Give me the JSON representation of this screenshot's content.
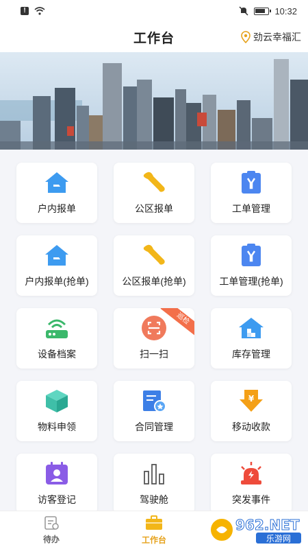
{
  "status_bar": {
    "time": "10:32"
  },
  "header": {
    "title": "工作台",
    "location": "劲云幸福汇"
  },
  "tiles": [
    {
      "label": "户内报单",
      "icon": "house-wrench-icon"
    },
    {
      "label": "公区报单",
      "icon": "wrench-icon"
    },
    {
      "label": "工单管理",
      "icon": "clipboard-wrench-icon"
    },
    {
      "label": "户内报单(抢单)",
      "icon": "house-wrench-icon"
    },
    {
      "label": "公区报单(抢单)",
      "icon": "wrench-icon"
    },
    {
      "label": "工单管理(抢单)",
      "icon": "clipboard-wrench-icon"
    },
    {
      "label": "设备档案",
      "icon": "router-icon"
    },
    {
      "label": "扫一扫",
      "icon": "scan-icon",
      "badge": "巡检"
    },
    {
      "label": "库存管理",
      "icon": "warehouse-icon"
    },
    {
      "label": "物料申领",
      "icon": "box-icon"
    },
    {
      "label": "合同管理",
      "icon": "contract-icon"
    },
    {
      "label": "移动收款",
      "icon": "payment-icon"
    },
    {
      "label": "访客登记",
      "icon": "visitor-icon"
    },
    {
      "label": "驾驶舱",
      "icon": "bar-chart-icon"
    },
    {
      "label": "突发事件",
      "icon": "alarm-icon"
    }
  ],
  "tabbar": [
    {
      "label": "待办",
      "icon": "todo-icon",
      "active": false
    },
    {
      "label": "工作台",
      "icon": "briefcase-icon",
      "active": true
    }
  ],
  "watermark": {
    "brand": "962.NET",
    "subtitle": "乐游网"
  },
  "colors": {
    "blue": "#3d9bf0",
    "yellow": "#f2b619",
    "active_tab": "#e6a21c",
    "ribbon": "#f36f4a"
  }
}
